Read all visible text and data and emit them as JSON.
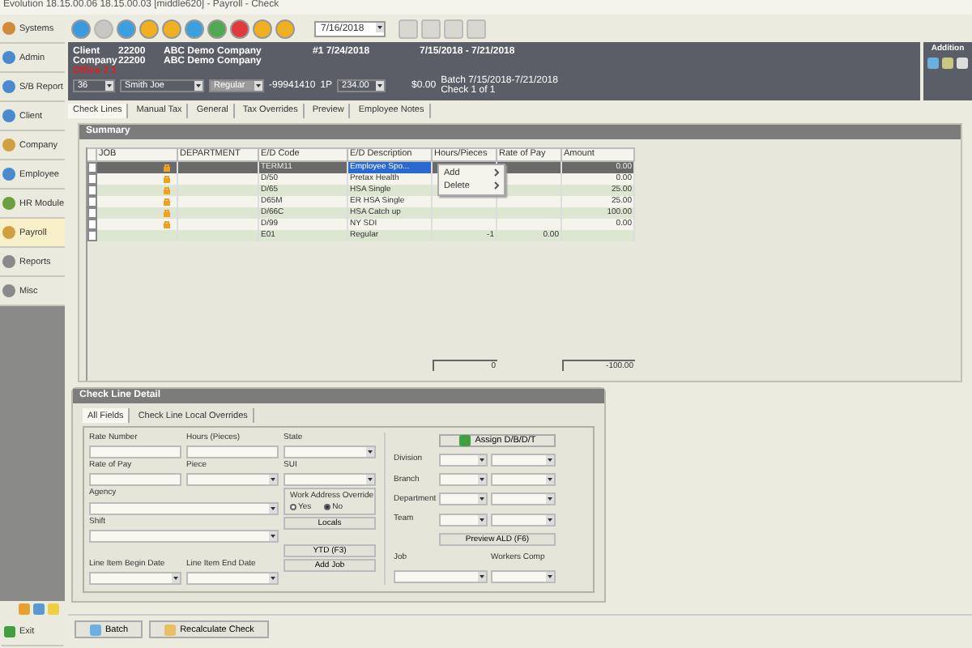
{
  "window": {
    "title": "Evolution 18.15.00.06  18.15.00.03 [middle620] - Payroll - Check"
  },
  "sidebar": {
    "items": [
      {
        "label": "Systems",
        "selected": false,
        "color": "#d08a3a"
      },
      {
        "label": "Admin",
        "selected": false,
        "color": "#4a8ad0"
      },
      {
        "label": "S/B Report",
        "selected": false,
        "color": "#4a8ad0"
      },
      {
        "label": "Client",
        "selected": false,
        "color": "#4a8ad0"
      },
      {
        "label": "Company",
        "selected": false,
        "color": "#d0a040"
      },
      {
        "label": "Employee",
        "selected": false,
        "color": "#4a8ad0"
      },
      {
        "label": "HR Module",
        "selected": false,
        "color": "#6aa040"
      },
      {
        "label": "Payroll",
        "selected": true,
        "color": "#d0a040"
      },
      {
        "label": "Reports",
        "selected": false,
        "color": "#8a8a8a"
      },
      {
        "label": "Misc",
        "selected": false,
        "color": "#8a8a8a"
      }
    ],
    "exit": "Exit"
  },
  "toolbar": {
    "buttons": [
      {
        "color": "#3a9ae0",
        "disabled": false
      },
      {
        "color": "#b0b0b0",
        "disabled": true
      },
      {
        "color": "#3aa0e0",
        "disabled": false
      },
      {
        "color": "#f0b020",
        "disabled": false
      },
      {
        "color": "#f0b020",
        "disabled": false
      },
      {
        "color": "#3aa0e0",
        "disabled": false
      },
      {
        "color": "#50a850",
        "disabled": false
      },
      {
        "color": "#e03a3a",
        "disabled": false
      },
      {
        "color": "#f0b020",
        "disabled": false
      },
      {
        "color": "#f0b020",
        "disabled": false
      }
    ],
    "date": "7/16/2018",
    "nav_buttons": [
      {
        "disabled": true
      },
      {
        "disabled": true
      },
      {
        "disabled": true
      },
      {
        "disabled": true
      }
    ]
  },
  "header": {
    "client_label": "Client",
    "client_number": "22200",
    "client_name": "ABC Demo Company",
    "company_label": "Company",
    "company_number": "22200",
    "company_name": "ABC Demo Company",
    "office": "Office 2 1",
    "check_info": "#1 7/24/2018",
    "period": "7/15/2018 - 7/21/2018",
    "employee_number": "36",
    "employee_name": "Smith Joe",
    "check_type": "Regular",
    "ssn": "-99941410",
    "frequency": "1P",
    "rate": "234.00",
    "net": "$0.00",
    "batch": "Batch 7/15/2018-7/21/2018",
    "check_count": "Check 1 of 1"
  },
  "additions_panel": {
    "title": "Addition"
  },
  "tabs": [
    {
      "label": "Check Lines",
      "selected": true
    },
    {
      "label": "Manual Tax",
      "selected": false
    },
    {
      "label": "General",
      "selected": false
    },
    {
      "label": "Tax Overrides",
      "selected": false
    },
    {
      "label": "Preview",
      "selected": false
    },
    {
      "label": "Employee Notes",
      "selected": false
    }
  ],
  "summary": {
    "title": "Summary",
    "columns": [
      "JOB",
      "DEPARTMENT",
      "E/D Code",
      "E/D Description",
      "Hours/Pieces",
      "Rate of Pay",
      "Amount"
    ],
    "rows": [
      {
        "selected": true,
        "locked": true,
        "code": "TERM11",
        "description": "Employee Spo...",
        "hours": "",
        "rate": "",
        "amount": "0.00"
      },
      {
        "selected": false,
        "locked": true,
        "code": "D/50",
        "description": "Pretax Health",
        "hours": "",
        "rate": "",
        "amount": "0.00"
      },
      {
        "selected": false,
        "locked": true,
        "code": "D/65",
        "description": "HSA Single",
        "hours": "",
        "rate": "",
        "amount": "25.00"
      },
      {
        "selected": false,
        "locked": true,
        "code": "D65M",
        "description": "ER HSA Single",
        "hours": "",
        "rate": "",
        "amount": "25.00"
      },
      {
        "selected": false,
        "locked": true,
        "code": "D/66C",
        "description": "HSA Catch up",
        "hours": "",
        "rate": "",
        "amount": "100.00"
      },
      {
        "selected": false,
        "locked": true,
        "code": "D/99",
        "description": "NY SDI",
        "hours": "",
        "rate": "",
        "amount": "0.00"
      },
      {
        "selected": false,
        "locked": false,
        "code": "E01",
        "description": "Regular",
        "hours": "-1",
        "rate": "0.00",
        "amount": ""
      }
    ],
    "total_hours": "0",
    "total_amount": "-100.00",
    "context_menu": [
      "Add",
      "Delete"
    ]
  },
  "detail": {
    "title": "Check Line Detail",
    "tabs": [
      {
        "label": "All Fields",
        "selected": true
      },
      {
        "label": "Check Line Local Overrides",
        "selected": false
      }
    ],
    "labels": {
      "rate_number": "Rate Number",
      "hours": "Hours (Pieces)",
      "state": "State",
      "rate_of_pay": "Rate of Pay",
      "piece": "Piece",
      "sui": "SUI",
      "agency": "Agency",
      "shift": "Shift",
      "begin_date": "Line Item Begin Date",
      "end_date": "Line Item End Date",
      "work_address": "Work Address Override",
      "division": "Division",
      "branch": "Branch",
      "department": "Department",
      "team": "Team",
      "job": "Job",
      "workers_comp": "Workers Comp"
    },
    "work_address_options": [
      {
        "label": "Yes",
        "selected": false
      },
      {
        "label": "No",
        "selected": true
      }
    ],
    "buttons": [
      "Locals",
      "YTD (F3)",
      "Add Job"
    ],
    "assign_button": "Assign D/B/D/T",
    "preview_button": "Preview ALD (F6)"
  },
  "bottom_buttons": [
    "Batch",
    "Recalculate Check"
  ]
}
